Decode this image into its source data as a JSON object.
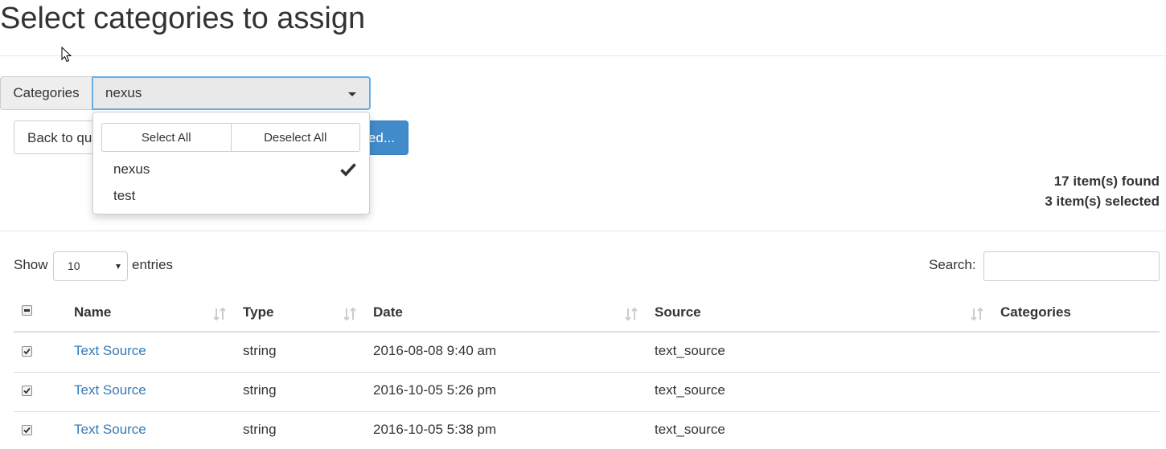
{
  "page": {
    "title": "Select categories to assign"
  },
  "filter": {
    "addon_label": "Categories",
    "selected_value": "nexus",
    "dropdown": {
      "select_all": "Select All",
      "deselect_all": "Deselect All",
      "options": [
        {
          "label": "nexus",
          "checked": true
        },
        {
          "label": "test",
          "checked": false
        }
      ]
    }
  },
  "actions": {
    "back_label": "Back to qu",
    "assign_label": "ed..."
  },
  "summary": {
    "found": "17 item(s) found",
    "selected": "3 item(s) selected"
  },
  "table_controls": {
    "show_label": "Show",
    "page_length": "10",
    "entries_label": "entries",
    "search_label": "Search:"
  },
  "table": {
    "columns": [
      "Name",
      "Type",
      "Date",
      "Source",
      "Categories"
    ],
    "rows": [
      {
        "checked": true,
        "name": "Text Source",
        "type": "string",
        "date": "2016-08-08 9:40 am",
        "source": "text_source",
        "categories": ""
      },
      {
        "checked": true,
        "name": "Text Source",
        "type": "string",
        "date": "2016-10-05 5:26 pm",
        "source": "text_source",
        "categories": ""
      },
      {
        "checked": true,
        "name": "Text Source",
        "type": "string",
        "date": "2016-10-05 5:38 pm",
        "source": "text_source",
        "categories": ""
      }
    ]
  },
  "colors": {
    "link": "#337ab7",
    "primary": "#428bca",
    "focus_border": "#66afe9"
  }
}
